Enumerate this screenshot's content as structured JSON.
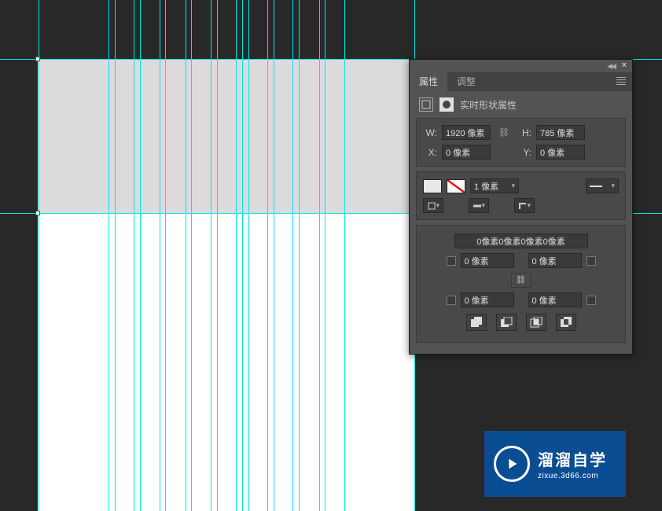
{
  "panel": {
    "tabs": {
      "active": "属性",
      "inactive": "调整"
    },
    "title": "实时形状属性",
    "size": {
      "w_label": "W:",
      "w_value": "1920 像素",
      "h_label": "H:",
      "h_value": "785 像素",
      "x_label": "X:",
      "x_value": "0 像素",
      "y_label": "Y:",
      "y_value": "0 像素"
    },
    "stroke": {
      "width": "1 像素"
    },
    "corners": {
      "summary": "0像素0像素0像素0像素",
      "tl": "0 像素",
      "tr": "0 像素",
      "bl": "0 像素",
      "br": "0 像素"
    }
  },
  "watermark": {
    "title": "溜溜自学",
    "sub": "zixue.3d66.com"
  }
}
